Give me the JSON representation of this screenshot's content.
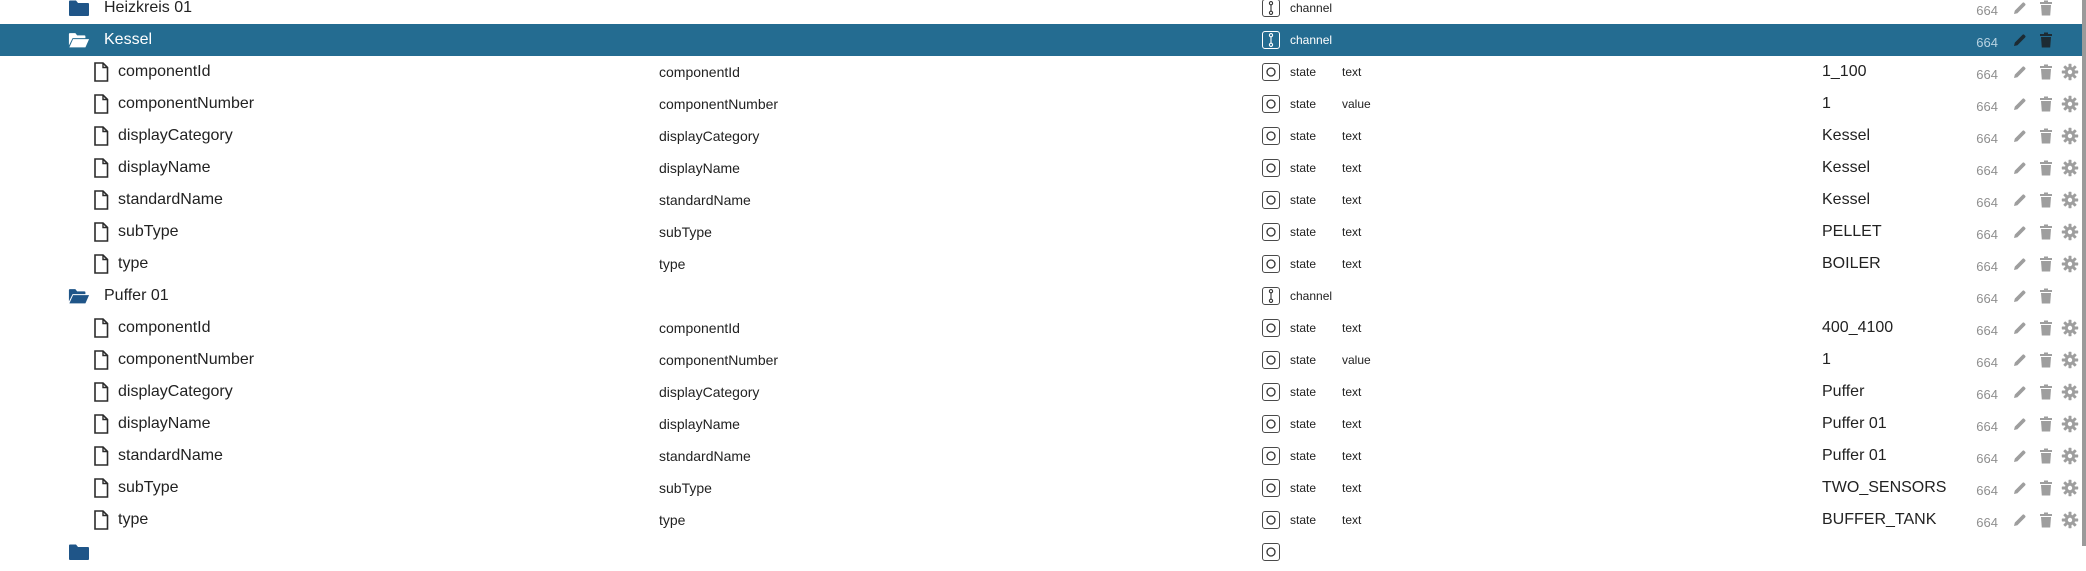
{
  "rows": [
    {
      "kind": "folder",
      "level": 0,
      "name": "Heizkreis 01",
      "name2": "",
      "type_icon": "channel-icon",
      "type": "channel",
      "role": "",
      "value": "",
      "acl": "664",
      "selected": false,
      "gear": false
    },
    {
      "kind": "folder-open",
      "level": 0,
      "name": "Kessel",
      "name2": "",
      "type_icon": "channel-icon",
      "type": "channel",
      "role": "",
      "value": "",
      "acl": "664",
      "selected": true,
      "gear": false
    },
    {
      "kind": "file",
      "level": 1,
      "name": "componentId",
      "name2": "componentId",
      "type_icon": "state-icon",
      "type": "state",
      "role": "text",
      "value": "1_100",
      "acl": "664",
      "selected": false,
      "gear": true
    },
    {
      "kind": "file",
      "level": 1,
      "name": "componentNumber",
      "name2": "componentNumber",
      "type_icon": "state-icon",
      "type": "state",
      "role": "value",
      "value": "1",
      "acl": "664",
      "selected": false,
      "gear": true
    },
    {
      "kind": "file",
      "level": 1,
      "name": "displayCategory",
      "name2": "displayCategory",
      "type_icon": "state-icon",
      "type": "state",
      "role": "text",
      "value": "Kessel",
      "acl": "664",
      "selected": false,
      "gear": true
    },
    {
      "kind": "file",
      "level": 1,
      "name": "displayName",
      "name2": "displayName",
      "type_icon": "state-icon",
      "type": "state",
      "role": "text",
      "value": "Kessel",
      "acl": "664",
      "selected": false,
      "gear": true
    },
    {
      "kind": "file",
      "level": 1,
      "name": "standardName",
      "name2": "standardName",
      "type_icon": "state-icon",
      "type": "state",
      "role": "text",
      "value": "Kessel",
      "acl": "664",
      "selected": false,
      "gear": true
    },
    {
      "kind": "file",
      "level": 1,
      "name": "subType",
      "name2": "subType",
      "type_icon": "state-icon",
      "type": "state",
      "role": "text",
      "value": "PELLET",
      "acl": "664",
      "selected": false,
      "gear": true
    },
    {
      "kind": "file",
      "level": 1,
      "name": "type",
      "name2": "type",
      "type_icon": "state-icon",
      "type": "state",
      "role": "text",
      "value": "BOILER",
      "acl": "664",
      "selected": false,
      "gear": true
    },
    {
      "kind": "folder-open",
      "level": 0,
      "name": "Puffer 01",
      "name2": "",
      "type_icon": "channel-icon",
      "type": "channel",
      "role": "",
      "value": "",
      "acl": "664",
      "selected": false,
      "gear": false
    },
    {
      "kind": "file",
      "level": 1,
      "name": "componentId",
      "name2": "componentId",
      "type_icon": "state-icon",
      "type": "state",
      "role": "text",
      "value": "400_4100",
      "acl": "664",
      "selected": false,
      "gear": true
    },
    {
      "kind": "file",
      "level": 1,
      "name": "componentNumber",
      "name2": "componentNumber",
      "type_icon": "state-icon",
      "type": "state",
      "role": "value",
      "value": "1",
      "acl": "664",
      "selected": false,
      "gear": true
    },
    {
      "kind": "file",
      "level": 1,
      "name": "displayCategory",
      "name2": "displayCategory",
      "type_icon": "state-icon",
      "type": "state",
      "role": "text",
      "value": "Puffer",
      "acl": "664",
      "selected": false,
      "gear": true
    },
    {
      "kind": "file",
      "level": 1,
      "name": "displayName",
      "name2": "displayName",
      "type_icon": "state-icon",
      "type": "state",
      "role": "text",
      "value": "Puffer 01",
      "acl": "664",
      "selected": false,
      "gear": true
    },
    {
      "kind": "file",
      "level": 1,
      "name": "standardName",
      "name2": "standardName",
      "type_icon": "state-icon",
      "type": "state",
      "role": "text",
      "value": "Puffer 01",
      "acl": "664",
      "selected": false,
      "gear": true
    },
    {
      "kind": "file",
      "level": 1,
      "name": "subType",
      "name2": "subType",
      "type_icon": "state-icon",
      "type": "state",
      "role": "text",
      "value": "TWO_SENSORS",
      "acl": "664",
      "selected": false,
      "gear": true
    },
    {
      "kind": "file",
      "level": 1,
      "name": "type",
      "name2": "type",
      "type_icon": "state-icon",
      "type": "state",
      "role": "text",
      "value": "BUFFER_TANK",
      "acl": "664",
      "selected": false,
      "gear": true
    },
    {
      "kind": "folder",
      "level": 0,
      "name": "",
      "name2": "",
      "type_icon": "state-icon",
      "type": "",
      "role": "",
      "value": "",
      "acl": "",
      "selected": false,
      "gear": false
    }
  ],
  "colors": {
    "selected_bg": "#246c91",
    "folder": "#1f5588",
    "icon": "#4a4a4a",
    "action": "#9e9e9e"
  }
}
